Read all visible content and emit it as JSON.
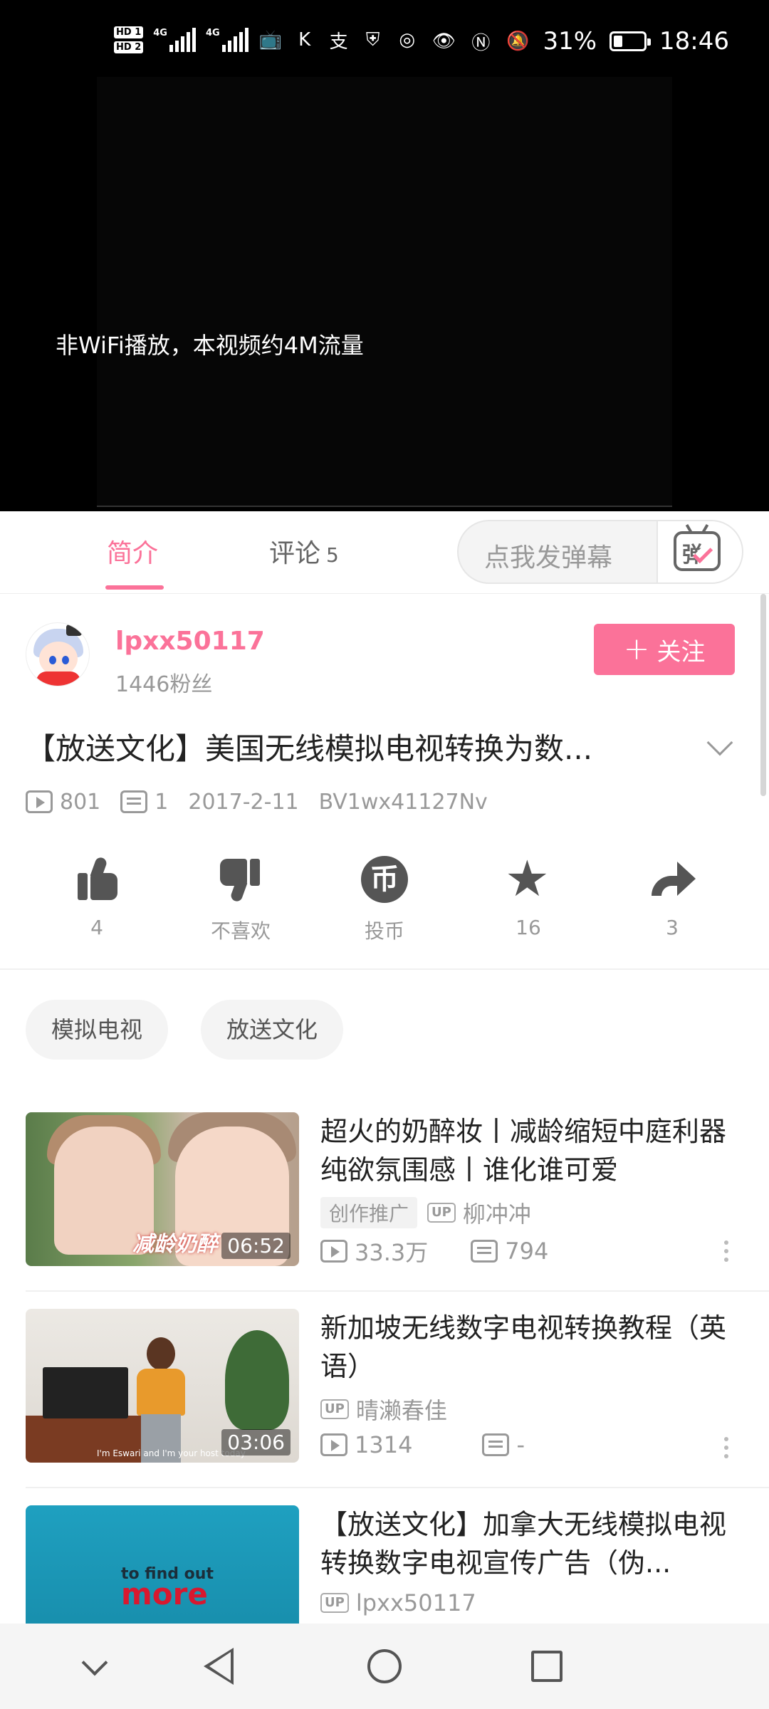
{
  "status_bar": {
    "hd1": "HD 1",
    "hd2": "HD 2",
    "net1": "4G",
    "net2": "4G",
    "battery_pct": "31%",
    "battery_level": 0.31,
    "time": "18:46"
  },
  "video": {
    "notice": "非WiFi播放，本视频约4M流量"
  },
  "tabs": {
    "intro": "简介",
    "comments": "评论",
    "comments_count": "5",
    "danmu_placeholder": "点我发弹幕",
    "danmu_char": "弹"
  },
  "uploader": {
    "name": "lpxx50117",
    "fans": "1446粉丝",
    "follow_label": "关注",
    "follow_plus": "+"
  },
  "video_info": {
    "title": "【放送文化】美国无线模拟电视转换为数...",
    "views": "801",
    "danmaku": "1",
    "date": "2017-2-11",
    "bvid": "BV1wx41127Nv"
  },
  "actions": {
    "like": "4",
    "dislike": "不喜欢",
    "coin": "投币",
    "coin_glyph": "币",
    "favorite": "16",
    "share": "3"
  },
  "tags": [
    "模拟电视",
    "放送文化"
  ],
  "recommendations": [
    {
      "title": "超火的奶醉妆丨减龄缩短中庭利器 纯欲氛围感丨谁化谁可爱",
      "promo": "创作推广",
      "up_badge": "UP",
      "author": "柳冲冲",
      "views": "33.3万",
      "danmaku": "794",
      "duration": "06:52",
      "thumb_caption": "减龄奶醉"
    },
    {
      "title": "新加坡无线数字电视转换教程（英语）",
      "up_badge": "UP",
      "author": "晴濑春佳",
      "views": "1314",
      "danmaku": "-",
      "duration": "03:06",
      "thumb_caption": "I'm Eswari and I'm your host today"
    },
    {
      "title": "【放送文化】加拿大无线模拟电视转换数字电视宣传广告（伪...",
      "up_badge": "UP",
      "author": "lpxx50117",
      "thumb_line1": "to find out",
      "thumb_line2": "more"
    }
  ],
  "colors": {
    "accent": "#fb7299",
    "text_primary": "#222222",
    "text_secondary": "#999999"
  }
}
